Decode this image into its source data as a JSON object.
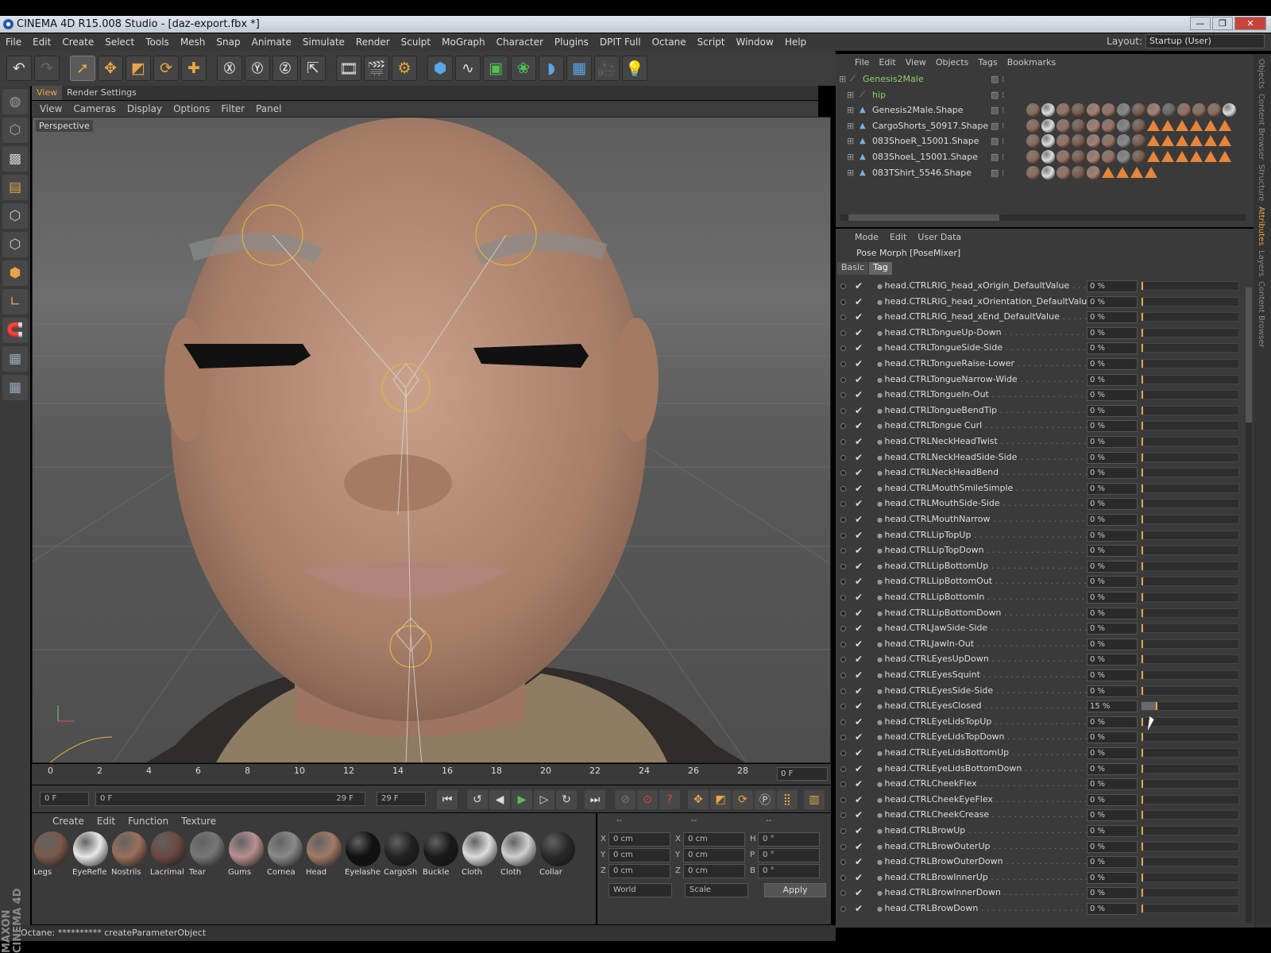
{
  "window": {
    "title": "CINEMA 4D R15.008 Studio - [daz-export.fbx *]",
    "buttons": [
      "—",
      "❐",
      "✕"
    ]
  },
  "menu": [
    "File",
    "Edit",
    "Create",
    "Select",
    "Tools",
    "Mesh",
    "Snap",
    "Animate",
    "Simulate",
    "Render",
    "Sculpt",
    "MoGraph",
    "Character",
    "Plugins",
    "DPIT Full",
    "Octane",
    "Script",
    "Window",
    "Help"
  ],
  "layout": {
    "label": "Layout:",
    "value": "Startup (User)"
  },
  "viewport": {
    "tabs": [
      "View",
      "Render Settings"
    ],
    "menu": [
      "View",
      "Cameras",
      "Display",
      "Options",
      "Filter",
      "Panel"
    ],
    "label": "Perspective"
  },
  "timeline": {
    "ticks": [
      "0",
      "2",
      "4",
      "6",
      "8",
      "10",
      "12",
      "14",
      "16",
      "18",
      "20",
      "22",
      "24",
      "26",
      "28"
    ],
    "current": "0 F"
  },
  "transport": {
    "start": "0 F",
    "range_start": "0 F",
    "range_end": "29 F",
    "end": "29 F"
  },
  "materials": {
    "menu": [
      "Create",
      "Edit",
      "Function",
      "Texture"
    ],
    "items": [
      {
        "label": "Legs",
        "color": "#7a5a4a"
      },
      {
        "label": "EyeRefle",
        "color": "#e8e8e8"
      },
      {
        "label": "Nostrils",
        "color": "#9a6f5a"
      },
      {
        "label": "Lacrimal",
        "color": "#6a4a42"
      },
      {
        "label": "Tear",
        "color": "#777777"
      },
      {
        "label": "Gums",
        "color": "#b89090"
      },
      {
        "label": "Cornea",
        "color": "#8a8a8a"
      },
      {
        "label": "Head",
        "color": "#a07a66"
      },
      {
        "label": "Eyelashe",
        "color": "#111111"
      },
      {
        "label": "CargoSh",
        "color": "#222222"
      },
      {
        "label": "Buckle",
        "color": "#1a1a1a"
      },
      {
        "label": "Cloth",
        "color": "#dcdcdc"
      },
      {
        "label": "Cloth",
        "color": "#cfcfcf"
      },
      {
        "label": "Collar",
        "color": "#2a2a2a"
      }
    ]
  },
  "coords": {
    "header": [
      "--",
      "--",
      "--"
    ],
    "rows": [
      {
        "a": "X",
        "av": "0 cm",
        "b": "X",
        "bv": "0 cm",
        "c": "H",
        "cv": "0 °"
      },
      {
        "a": "Y",
        "av": "0 cm",
        "b": "Y",
        "bv": "0 cm",
        "c": "P",
        "cv": "0 °"
      },
      {
        "a": "Z",
        "av": "0 cm",
        "b": "Z",
        "bv": "0 cm",
        "c": "B",
        "cv": "0 °"
      }
    ],
    "mode1": "World",
    "mode2": "Scale",
    "apply": "Apply"
  },
  "status": "Octane: ********** createParameterObject",
  "maxon": "MAXON CINEMA 4D",
  "objects": {
    "menu": [
      "File",
      "Edit",
      "View",
      "Objects",
      "Tags",
      "Bookmarks"
    ],
    "items": [
      {
        "name": "Genesis2Male",
        "green": true
      },
      {
        "name": "hip",
        "green": true
      },
      {
        "name": "Genesis2Male.Shape",
        "green": false
      },
      {
        "name": "CargoShorts_50917.Shape",
        "green": false
      },
      {
        "name": "083ShoeR_15001.Shape",
        "green": false
      },
      {
        "name": "083ShoeL_15001.Shape",
        "green": false
      },
      {
        "name": "083TShirt_5546.Shape",
        "green": false
      }
    ]
  },
  "side_tabs": [
    "Objects",
    "Content Browser",
    "Structure",
    "Attributes",
    "Layers",
    "Content Browser"
  ],
  "attributes": {
    "menu": [
      "Mode",
      "Edit",
      "User Data"
    ],
    "title": "Pose Morph [PoseMixer]",
    "tabs": [
      "Basic",
      "Tag"
    ],
    "params": [
      {
        "name": "head.CTRLRIG_head_xOrigin_DefaultValue",
        "value": "0 %"
      },
      {
        "name": "head.CTRLRIG_head_xOrientation_DefaultValue",
        "value": "0 %"
      },
      {
        "name": "head.CTRLRIG_head_xEnd_DefaultValue",
        "value": "0 %"
      },
      {
        "name": "head.CTRLTongueUp-Down",
        "value": "0 %"
      },
      {
        "name": "head.CTRLTongueSide-Side",
        "value": "0 %"
      },
      {
        "name": "head.CTRLTongueRaise-Lower",
        "value": "0 %"
      },
      {
        "name": "head.CTRLTongueNarrow-Wide",
        "value": "0 %"
      },
      {
        "name": "head.CTRLTongueIn-Out",
        "value": "0 %"
      },
      {
        "name": "head.CTRLTongueBendTip",
        "value": "0 %"
      },
      {
        "name": "head.CTRLTongue Curl",
        "value": "0 %"
      },
      {
        "name": "head.CTRLNeckHeadTwist",
        "value": "0 %"
      },
      {
        "name": "head.CTRLNeckHeadSide-Side",
        "value": "0 %"
      },
      {
        "name": "head.CTRLNeckHeadBend",
        "value": "0 %"
      },
      {
        "name": "head.CTRLMouthSmileSimple",
        "value": "0 %"
      },
      {
        "name": "head.CTRLMouthSide-Side",
        "value": "0 %"
      },
      {
        "name": "head.CTRLMouthNarrow",
        "value": "0 %"
      },
      {
        "name": "head.CTRLLipTopUp",
        "value": "0 %"
      },
      {
        "name": "head.CTRLLipTopDown",
        "value": "0 %"
      },
      {
        "name": "head.CTRLLipBottomUp",
        "value": "0 %"
      },
      {
        "name": "head.CTRLLipBottomOut",
        "value": "0 %"
      },
      {
        "name": "head.CTRLLipBottomIn",
        "value": "0 %"
      },
      {
        "name": "head.CTRLLipBottomDown",
        "value": "0 %"
      },
      {
        "name": "head.CTRLJawSide-Side",
        "value": "0 %"
      },
      {
        "name": "head.CTRLJawIn-Out",
        "value": "0 %"
      },
      {
        "name": "head.CTRLEyesUpDown",
        "value": "0 %"
      },
      {
        "name": "head.CTRLEyesSquint",
        "value": "0 %"
      },
      {
        "name": "head.CTRLEyesSide-Side",
        "value": "0 %"
      },
      {
        "name": "head.CTRLEyesClosed",
        "value": "15 %",
        "level": 0.15
      },
      {
        "name": "head.CTRLEyeLidsTopUp",
        "value": "0 %"
      },
      {
        "name": "head.CTRLEyeLidsTopDown",
        "value": "0 %"
      },
      {
        "name": "head.CTRLEyeLidsBottomUp",
        "value": "0 %"
      },
      {
        "name": "head.CTRLEyeLidsBottomDown",
        "value": "0 %"
      },
      {
        "name": "head.CTRLCheekFlex",
        "value": "0 %"
      },
      {
        "name": "head.CTRLCheekEyeFlex",
        "value": "0 %"
      },
      {
        "name": "head.CTRLCheekCrease",
        "value": "0 %"
      },
      {
        "name": "head.CTRLBrowUp",
        "value": "0 %"
      },
      {
        "name": "head.CTRLBrowOuterUp",
        "value": "0 %"
      },
      {
        "name": "head.CTRLBrowOuterDown",
        "value": "0 %"
      },
      {
        "name": "head.CTRLBrowInnerUp",
        "value": "0 %"
      },
      {
        "name": "head.CTRLBrowInnerDown",
        "value": "0 %"
      },
      {
        "name": "head.CTRLBrowDown",
        "value": "0 %"
      }
    ]
  }
}
